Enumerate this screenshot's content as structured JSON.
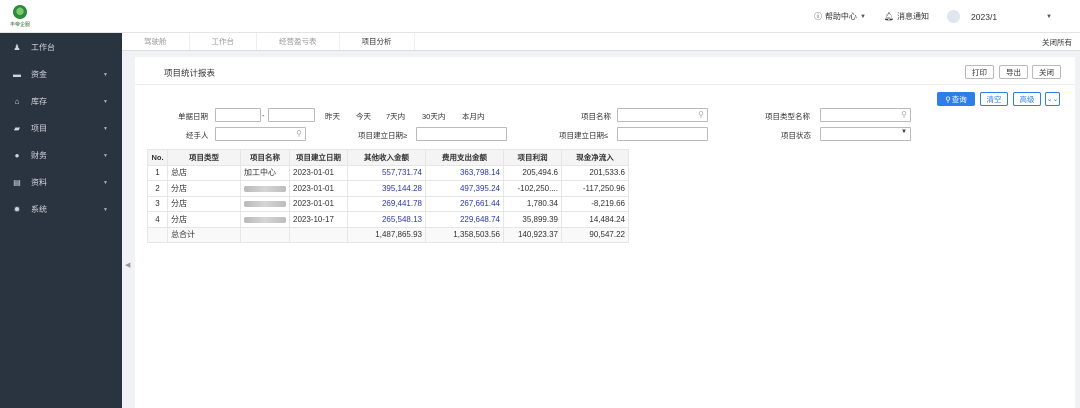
{
  "header": {
    "logo_text": "丰帝企服",
    "help_label": "帮助中心",
    "notice_label": "消息通知",
    "user_name": "2023/1"
  },
  "sidebar": {
    "items": [
      {
        "label": "工作台",
        "icon": "user-icon",
        "glyph": "♟",
        "has_arrow": false
      },
      {
        "label": "资金",
        "icon": "money-icon",
        "glyph": "▬",
        "has_arrow": true
      },
      {
        "label": "库存",
        "icon": "warehouse-icon",
        "glyph": "⌂",
        "has_arrow": true
      },
      {
        "label": "项目",
        "icon": "folder-icon",
        "glyph": "▰",
        "has_arrow": true
      },
      {
        "label": "财务",
        "icon": "finance-icon",
        "glyph": "●",
        "has_arrow": true
      },
      {
        "label": "资料",
        "icon": "data-icon",
        "glyph": "▤",
        "has_arrow": true
      },
      {
        "label": "系统",
        "icon": "gear-icon",
        "glyph": "✹",
        "has_arrow": true
      }
    ]
  },
  "tabs": [
    {
      "label": "驾驶舱",
      "active": false
    },
    {
      "label": "工作台",
      "active": false
    },
    {
      "label": "经营盈亏表",
      "active": false
    },
    {
      "label": "项目分析",
      "active": true
    }
  ],
  "close_all_label": "关闭所有",
  "page": {
    "title": "项目统计报表",
    "print_label": "打印",
    "export_label": "导出",
    "close_label": "关闭"
  },
  "filters": {
    "query_label": "查询",
    "clear_label": "清空",
    "advanced_label": "高级",
    "expand_icon": "double-chevron-down-icon",
    "date_label": "单据日期",
    "date_sep": "-",
    "quick_dates": [
      "昨天",
      "今天",
      "7天内",
      "30天内",
      "本月内"
    ],
    "project_name_label": "项目名称",
    "project_type_name_label": "项目类型名称",
    "handler_label": "经手人",
    "create_date_ge_label": "项目建立日期≥",
    "create_date_le_label": "项目建立日期≤",
    "status_label": "项目状态"
  },
  "table": {
    "columns": [
      "No.",
      "项目类型",
      "项目名称",
      "项目建立日期",
      "其他收入金额",
      "费用支出金额",
      "项目利润",
      "现金净流入"
    ],
    "rows": [
      {
        "no": "1",
        "type": "总店",
        "name": "加工中心",
        "name_blurred": false,
        "date": "2023-01-01",
        "income": "557,731.74",
        "expense": "363,798.14",
        "profit": "205,494.6",
        "cash": "201,533.6"
      },
      {
        "no": "2",
        "type": "分店",
        "name": "",
        "name_blurred": true,
        "date": "2023-01-01",
        "income": "395,144.28",
        "expense": "497,395.24",
        "profit": "-102,250....",
        "cash": "-117,250.96"
      },
      {
        "no": "3",
        "type": "分店",
        "name": "",
        "name_blurred": true,
        "date": "2023-01-01",
        "income": "269,441.78",
        "expense": "267,661.44",
        "profit": "1,780.34",
        "cash": "-8,219.66"
      },
      {
        "no": "4",
        "type": "分店",
        "name": "",
        "name_blurred": true,
        "date": "2023-10-17",
        "income": "265,548.13",
        "expense": "229,648.74",
        "profit": "35,899.39",
        "cash": "14,484.24"
      }
    ],
    "total": {
      "label": "总合计",
      "income": "1,487,865.93",
      "expense": "1,358,503.56",
      "profit": "140,923.37",
      "cash": "90,547.22"
    }
  },
  "colors": {
    "sidebar_bg": "#2a3441",
    "primary": "#2f7ee8",
    "link": "#2b38b8"
  }
}
